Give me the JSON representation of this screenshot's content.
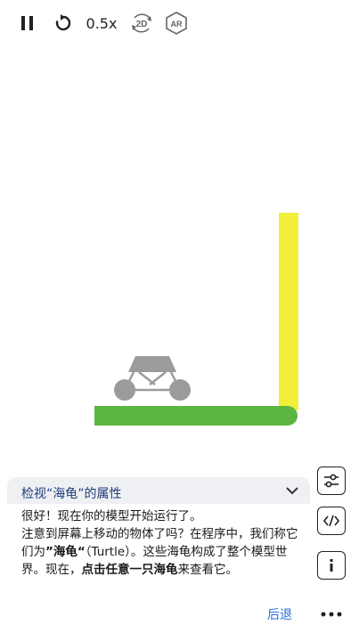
{
  "toolbar": {
    "speed_label": "0.5x",
    "view_2d_label": "2D",
    "ar_label": "AR"
  },
  "panel": {
    "title": "检视“海龟”的属性",
    "line1": "很好！现在你的模型开始运行了。",
    "line2a": "注意到屏幕上移动的物体了吗？在程序中，我们称它们为",
    "line2_bold": "”海龟“",
    "line2b": "（Turtle）。这些海龟构成了整个模型世界。现在，",
    "line3_bold": "点击任意一只海龟",
    "line3b": "来查看它。",
    "back_label": "后退"
  },
  "colors": {
    "yellow_wall": "#f1ef3a",
    "green_ground": "#5bb540",
    "vehicle_gray": "#9b9b9b",
    "link_blue": "#2d6fd1"
  }
}
